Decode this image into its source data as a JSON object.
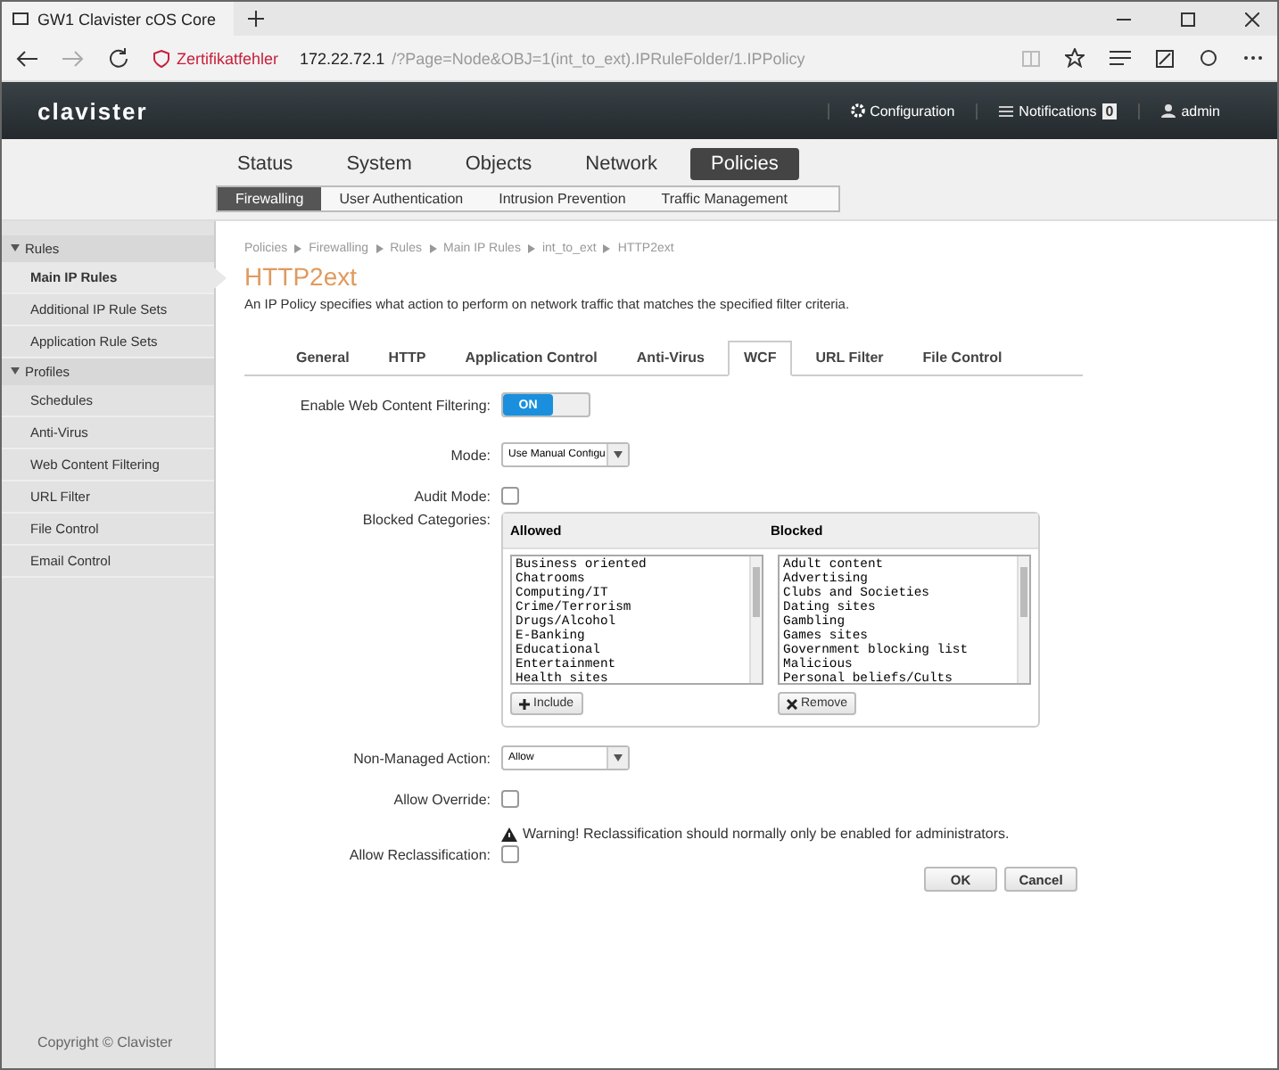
{
  "browser": {
    "tab_title": "GW1 Clavister cOS Core",
    "cert_warning": "Zertifikatfehler",
    "url_host": "172.22.72.1",
    "url_path": "/?Page=Node&OBJ=1(int_to_ext).IPRuleFolder/1.IPPolicy"
  },
  "header": {
    "logo": "clavister",
    "configuration": "Configuration",
    "notifications": "Notifications",
    "notifications_count": "0",
    "user": "admin"
  },
  "main_tabs": [
    {
      "label": "Status",
      "selected": false
    },
    {
      "label": "System",
      "selected": false
    },
    {
      "label": "Objects",
      "selected": false
    },
    {
      "label": "Network",
      "selected": false
    },
    {
      "label": "Policies",
      "selected": true
    }
  ],
  "sub_tabs": [
    {
      "label": "Firewalling",
      "selected": true
    },
    {
      "label": "User Authentication",
      "selected": false
    },
    {
      "label": "Intrusion Prevention",
      "selected": false
    },
    {
      "label": "Traffic Management",
      "selected": false
    }
  ],
  "sidebar": {
    "sections": [
      {
        "title": "Rules",
        "expanded": true,
        "items": [
          {
            "label": "Main IP Rules",
            "selected": true
          },
          {
            "label": "Additional IP Rule Sets",
            "selected": false
          },
          {
            "label": "Application Rule Sets",
            "selected": false
          }
        ]
      },
      {
        "title": "Profiles",
        "expanded": true,
        "items": [
          {
            "label": "Schedules",
            "selected": false
          },
          {
            "label": "Anti-Virus",
            "selected": false
          },
          {
            "label": "Web Content Filtering",
            "selected": false
          },
          {
            "label": "URL Filter",
            "selected": false
          },
          {
            "label": "File Control",
            "selected": false
          },
          {
            "label": "Email Control",
            "selected": false
          }
        ]
      }
    ],
    "copyright": "Copyright © Clavister"
  },
  "breadcrumb": [
    "Policies",
    "Firewalling",
    "Rules",
    "Main IP Rules",
    "int_to_ext",
    "HTTP2ext"
  ],
  "title": "HTTP2ext",
  "description": "An IP Policy specifies what action to perform on network traffic that matches the specified filter criteria.",
  "tabs": [
    {
      "label": "General",
      "selected": false
    },
    {
      "label": "HTTP",
      "selected": false
    },
    {
      "label": "Application Control",
      "selected": false
    },
    {
      "label": "Anti-Virus",
      "selected": false
    },
    {
      "label": "WCF",
      "selected": true
    },
    {
      "label": "URL Filter",
      "selected": false
    },
    {
      "label": "File Control",
      "selected": false
    }
  ],
  "form": {
    "enable_wcf": {
      "label": "Enable Web Content Filtering:",
      "on": true,
      "on_text": "ON"
    },
    "mode": {
      "label": "Mode:",
      "value": "Use Manual Configu"
    },
    "audit_mode": {
      "label": "Audit Mode:",
      "checked": false
    },
    "blocked_categories": {
      "label": "Blocked Categories:",
      "allowed_heading": "Allowed",
      "blocked_heading": "Blocked",
      "allowed": [
        "Business oriented",
        "Chatrooms",
        "Computing/IT",
        "Crime/Terrorism",
        "Drugs/Alcohol",
        "E-Banking",
        "Educational",
        "Entertainment",
        "Health sites"
      ],
      "blocked": [
        "Adult content",
        "Advertising",
        "Clubs and Societies",
        "Dating sites",
        "Gambling",
        "Games sites",
        "Government blocking list",
        "Malicious",
        "Personal beliefs/Cults"
      ],
      "include_button": "Include",
      "remove_button": "Remove"
    },
    "non_managed_action": {
      "label": "Non-Managed Action:",
      "value": "Allow"
    },
    "allow_override": {
      "label": "Allow Override:",
      "checked": false
    },
    "warning": "Warning! Reclassification should normally only be enabled for administrators.",
    "allow_reclassification": {
      "label": "Allow Reclassification:",
      "checked": false
    }
  },
  "buttons": [
    "OK",
    "Cancel"
  ]
}
